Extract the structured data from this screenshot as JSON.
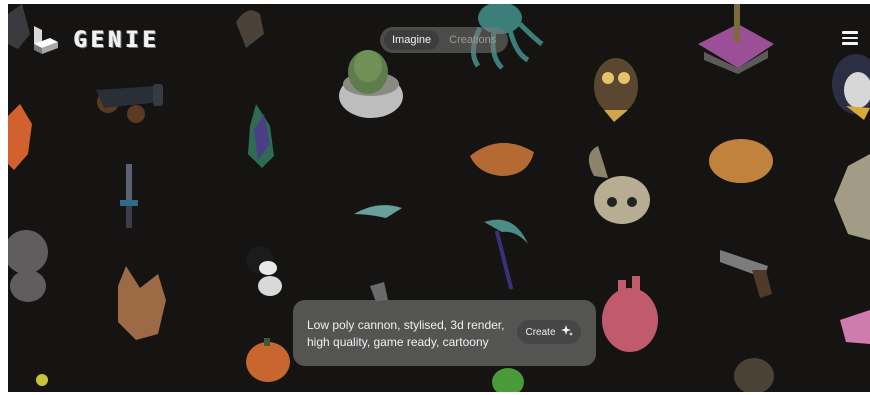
{
  "app": {
    "logo_text": "GENIE"
  },
  "tabs": [
    {
      "label": "Imagine",
      "active": true
    },
    {
      "label": "Creations",
      "active": false
    }
  ],
  "prompt": {
    "text": "Low poly cannon, stylised, 3d render, high quality, game ready, cartoony",
    "create_label": "Create"
  },
  "icons": [
    "logo-mark-icon",
    "menu-icon",
    "sparkle-icon"
  ],
  "colors": {
    "background": "#151412",
    "panel": "#5f5f5f",
    "text": "#f0f0f0"
  }
}
